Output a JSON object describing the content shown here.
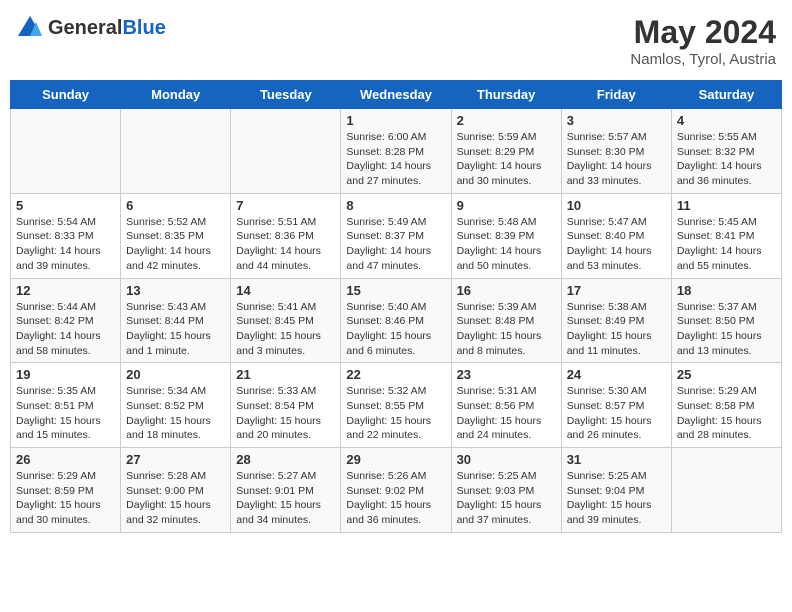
{
  "header": {
    "logo_general": "General",
    "logo_blue": "Blue",
    "title": "May 2024",
    "subtitle": "Namlos, Tyrol, Austria"
  },
  "weekdays": [
    "Sunday",
    "Monday",
    "Tuesday",
    "Wednesday",
    "Thursday",
    "Friday",
    "Saturday"
  ],
  "weeks": [
    [
      {
        "day": "",
        "info": ""
      },
      {
        "day": "",
        "info": ""
      },
      {
        "day": "",
        "info": ""
      },
      {
        "day": "1",
        "info": "Sunrise: 6:00 AM\nSunset: 8:28 PM\nDaylight: 14 hours and 27 minutes."
      },
      {
        "day": "2",
        "info": "Sunrise: 5:59 AM\nSunset: 8:29 PM\nDaylight: 14 hours and 30 minutes."
      },
      {
        "day": "3",
        "info": "Sunrise: 5:57 AM\nSunset: 8:30 PM\nDaylight: 14 hours and 33 minutes."
      },
      {
        "day": "4",
        "info": "Sunrise: 5:55 AM\nSunset: 8:32 PM\nDaylight: 14 hours and 36 minutes."
      }
    ],
    [
      {
        "day": "5",
        "info": "Sunrise: 5:54 AM\nSunset: 8:33 PM\nDaylight: 14 hours and 39 minutes."
      },
      {
        "day": "6",
        "info": "Sunrise: 5:52 AM\nSunset: 8:35 PM\nDaylight: 14 hours and 42 minutes."
      },
      {
        "day": "7",
        "info": "Sunrise: 5:51 AM\nSunset: 8:36 PM\nDaylight: 14 hours and 44 minutes."
      },
      {
        "day": "8",
        "info": "Sunrise: 5:49 AM\nSunset: 8:37 PM\nDaylight: 14 hours and 47 minutes."
      },
      {
        "day": "9",
        "info": "Sunrise: 5:48 AM\nSunset: 8:39 PM\nDaylight: 14 hours and 50 minutes."
      },
      {
        "day": "10",
        "info": "Sunrise: 5:47 AM\nSunset: 8:40 PM\nDaylight: 14 hours and 53 minutes."
      },
      {
        "day": "11",
        "info": "Sunrise: 5:45 AM\nSunset: 8:41 PM\nDaylight: 14 hours and 55 minutes."
      }
    ],
    [
      {
        "day": "12",
        "info": "Sunrise: 5:44 AM\nSunset: 8:42 PM\nDaylight: 14 hours and 58 minutes."
      },
      {
        "day": "13",
        "info": "Sunrise: 5:43 AM\nSunset: 8:44 PM\nDaylight: 15 hours and 1 minute."
      },
      {
        "day": "14",
        "info": "Sunrise: 5:41 AM\nSunset: 8:45 PM\nDaylight: 15 hours and 3 minutes."
      },
      {
        "day": "15",
        "info": "Sunrise: 5:40 AM\nSunset: 8:46 PM\nDaylight: 15 hours and 6 minutes."
      },
      {
        "day": "16",
        "info": "Sunrise: 5:39 AM\nSunset: 8:48 PM\nDaylight: 15 hours and 8 minutes."
      },
      {
        "day": "17",
        "info": "Sunrise: 5:38 AM\nSunset: 8:49 PM\nDaylight: 15 hours and 11 minutes."
      },
      {
        "day": "18",
        "info": "Sunrise: 5:37 AM\nSunset: 8:50 PM\nDaylight: 15 hours and 13 minutes."
      }
    ],
    [
      {
        "day": "19",
        "info": "Sunrise: 5:35 AM\nSunset: 8:51 PM\nDaylight: 15 hours and 15 minutes."
      },
      {
        "day": "20",
        "info": "Sunrise: 5:34 AM\nSunset: 8:52 PM\nDaylight: 15 hours and 18 minutes."
      },
      {
        "day": "21",
        "info": "Sunrise: 5:33 AM\nSunset: 8:54 PM\nDaylight: 15 hours and 20 minutes."
      },
      {
        "day": "22",
        "info": "Sunrise: 5:32 AM\nSunset: 8:55 PM\nDaylight: 15 hours and 22 minutes."
      },
      {
        "day": "23",
        "info": "Sunrise: 5:31 AM\nSunset: 8:56 PM\nDaylight: 15 hours and 24 minutes."
      },
      {
        "day": "24",
        "info": "Sunrise: 5:30 AM\nSunset: 8:57 PM\nDaylight: 15 hours and 26 minutes."
      },
      {
        "day": "25",
        "info": "Sunrise: 5:29 AM\nSunset: 8:58 PM\nDaylight: 15 hours and 28 minutes."
      }
    ],
    [
      {
        "day": "26",
        "info": "Sunrise: 5:29 AM\nSunset: 8:59 PM\nDaylight: 15 hours and 30 minutes."
      },
      {
        "day": "27",
        "info": "Sunrise: 5:28 AM\nSunset: 9:00 PM\nDaylight: 15 hours and 32 minutes."
      },
      {
        "day": "28",
        "info": "Sunrise: 5:27 AM\nSunset: 9:01 PM\nDaylight: 15 hours and 34 minutes."
      },
      {
        "day": "29",
        "info": "Sunrise: 5:26 AM\nSunset: 9:02 PM\nDaylight: 15 hours and 36 minutes."
      },
      {
        "day": "30",
        "info": "Sunrise: 5:25 AM\nSunset: 9:03 PM\nDaylight: 15 hours and 37 minutes."
      },
      {
        "day": "31",
        "info": "Sunrise: 5:25 AM\nSunset: 9:04 PM\nDaylight: 15 hours and 39 minutes."
      },
      {
        "day": "",
        "info": ""
      }
    ]
  ]
}
